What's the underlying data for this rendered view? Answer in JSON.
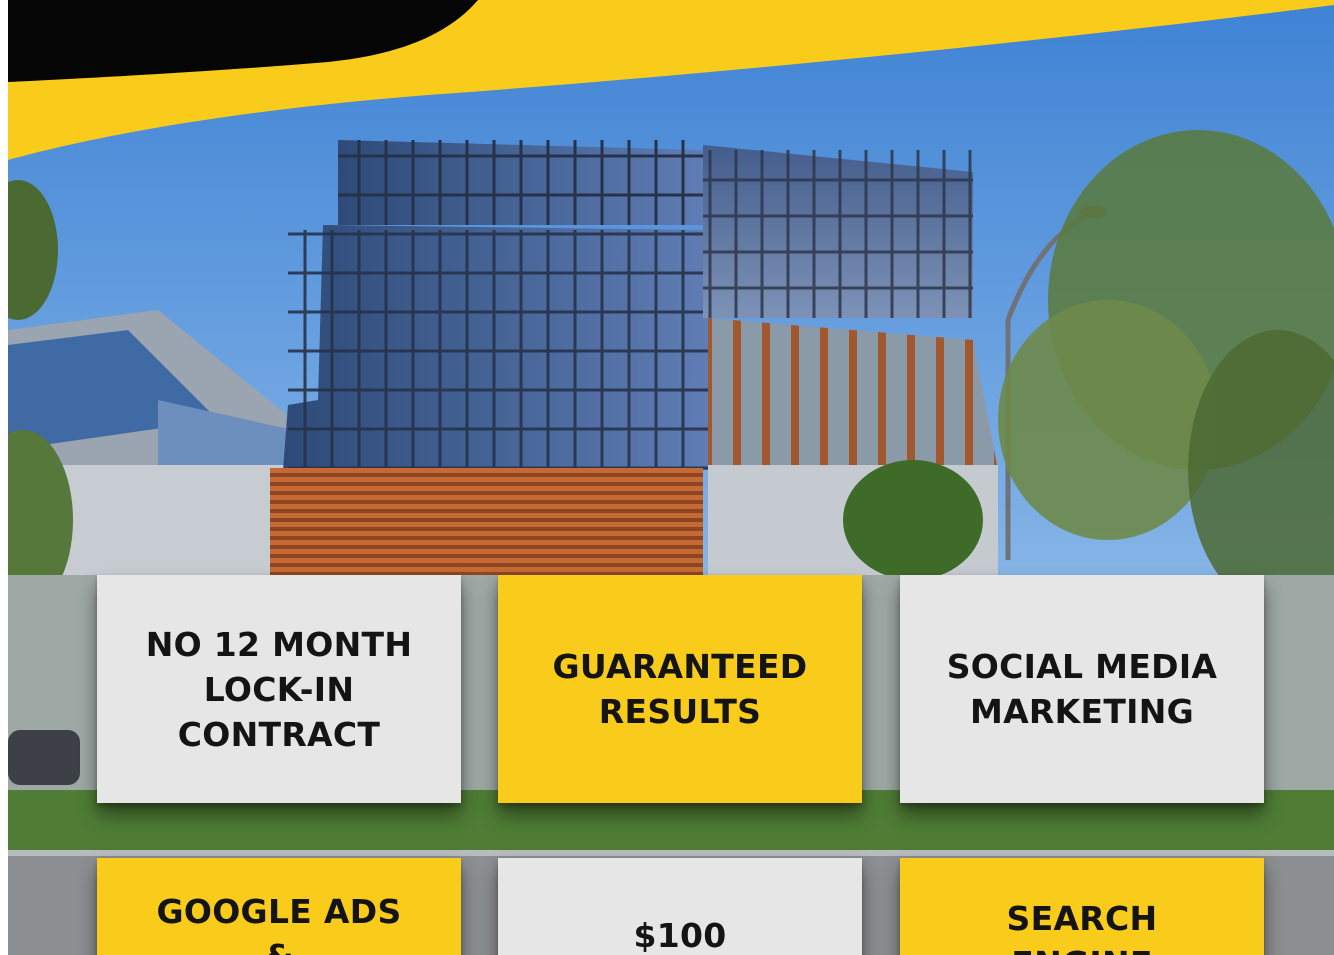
{
  "colors": {
    "brand_yellow": "#f9cb1a",
    "brand_black": "#050505",
    "card_grey": "#e6e6e6",
    "text_dark": "#141414"
  },
  "features": [
    {
      "label": "NO 12 MONTH\nLOCK-IN\nCONTRACT",
      "style": "grey"
    },
    {
      "label": "GUARANTEED\nRESULTS",
      "style": "yellow"
    },
    {
      "label": "SOCIAL MEDIA\nMARKETING",
      "style": "grey"
    },
    {
      "label": "GOOGLE ADS\n&",
      "style": "yellow"
    },
    {
      "label": "$100",
      "style": "grey"
    },
    {
      "label": "SEARCH\nENGINE",
      "style": "yellow"
    }
  ]
}
